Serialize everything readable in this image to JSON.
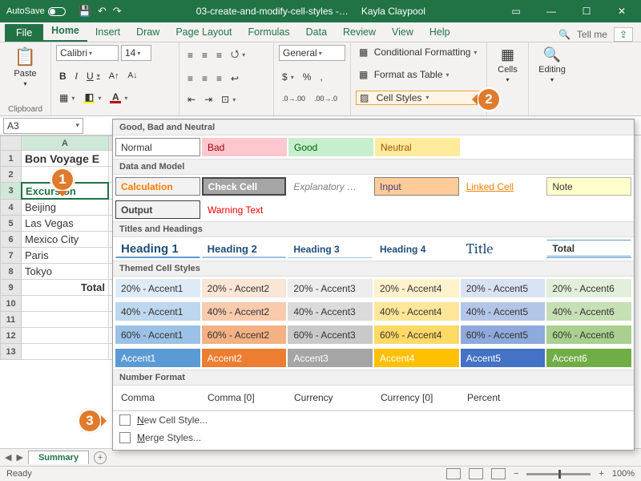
{
  "titlebar": {
    "autosave": "AutoSave",
    "filename": "03-create-and-modify-cell-styles -…",
    "username": "Kayla Claypool"
  },
  "tabs": {
    "file": "File",
    "home": "Home",
    "insert": "Insert",
    "draw": "Draw",
    "pagelayout": "Page Layout",
    "formulas": "Formulas",
    "data": "Data",
    "review": "Review",
    "view": "View",
    "help": "Help",
    "tellme": "Tell me"
  },
  "ribbon": {
    "clipboard": {
      "paste": "Paste",
      "label": "Clipboard"
    },
    "font": {
      "name": "Calibri",
      "size": "14"
    },
    "number": {
      "format": "General"
    },
    "styles": {
      "conditional": "Conditional Formatting",
      "table": "Format as Table",
      "cellstyles": "Cell Styles"
    },
    "cells": "Cells",
    "editing": "Editing"
  },
  "namebox": "A3",
  "rows": {
    "1": "Bon Voyage E",
    "3": "Excursion",
    "4": "Beijing",
    "5": "Las Vegas",
    "6": "Mexico City",
    "7": "Paris",
    "8": "Tokyo",
    "9": "Total"
  },
  "gallery": {
    "sections": {
      "s1": "Good, Bad and Neutral",
      "s2": "Data and Model",
      "s3": "Titles and Headings",
      "s4": "Themed Cell Styles",
      "s5": "Number Format"
    },
    "gbN": {
      "normal": "Normal",
      "bad": "Bad",
      "good": "Good",
      "neutral": "Neutral"
    },
    "dm": {
      "calc": "Calculation",
      "check": "Check Cell",
      "expl": "Explanatory …",
      "input": "Input",
      "linked": "Linked Cell",
      "note": "Note",
      "output": "Output",
      "warn": "Warning Text"
    },
    "th": {
      "h1": "Heading 1",
      "h2": "Heading 2",
      "h3": "Heading 3",
      "h4": "Heading 4",
      "title": "Title",
      "total": "Total"
    },
    "accent": {
      "p20": [
        "20% - Accent1",
        "20% - Accent2",
        "20% - Accent3",
        "20% - Accent4",
        "20% - Accent5",
        "20% - Accent6"
      ],
      "p40": [
        "40% - Accent1",
        "40% - Accent2",
        "40% - Accent3",
        "40% - Accent4",
        "40% - Accent5",
        "40% - Accent6"
      ],
      "p60": [
        "60% - Accent1",
        "60% - Accent2",
        "60% - Accent3",
        "60% - Accent4",
        "60% - Accent5",
        "60% - Accent6"
      ],
      "full": [
        "Accent1",
        "Accent2",
        "Accent3",
        "Accent4",
        "Accent5",
        "Accent6"
      ]
    },
    "num": {
      "comma": "Comma",
      "comma0": "Comma [0]",
      "curr": "Currency",
      "curr0": "Currency [0]",
      "pct": "Percent"
    },
    "menu": {
      "new": "New Cell Style...",
      "merge": "Merge Styles..."
    }
  },
  "sheet": {
    "tab": "Summary"
  },
  "status": {
    "ready": "Ready",
    "zoom": "100%"
  },
  "callouts": {
    "c1": "1",
    "c2": "2",
    "c3": "3"
  },
  "colors": {
    "acc1": "#5b9bd5",
    "acc2": "#ed7d31",
    "acc3": "#a5a5a5",
    "acc4": "#ffc000",
    "acc5": "#4472c4",
    "acc6": "#70ad47"
  }
}
